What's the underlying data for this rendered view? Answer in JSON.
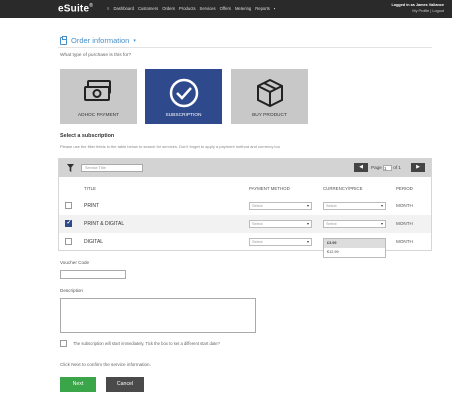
{
  "app": {
    "logo": "eSuite",
    "logo_mark": "®",
    "nav": [
      "Dashboard",
      "Customers",
      "Orders",
      "Products",
      "Services",
      "Offers",
      "Metering",
      "Reports"
    ],
    "user_line1": "Logged in as James Vallance",
    "user_line2": "My Profile | Logout"
  },
  "order": {
    "header": "Order information",
    "question": "What type of purchase is this for?",
    "types": [
      {
        "label": "ADHOC PAYMENT",
        "icon": "cash-icon",
        "selected": false
      },
      {
        "label": "SUBSCRIPTION",
        "icon": "checkmark-circle-icon",
        "selected": true
      },
      {
        "label": "BUY PRODUCT",
        "icon": "box-icon",
        "selected": false
      }
    ]
  },
  "subscription": {
    "title": "Select a subscription",
    "help": "Please use the filter fields in the table below to search for services. Don't forget to apply a payment method and currency too",
    "search_placeholder": "Service Title",
    "page_label": "Page",
    "page_value": "1",
    "page_of": "of 1",
    "columns": {
      "title": "TITLE",
      "payment": "PAYMENT METHOD",
      "currency": "CURRENCY/PRICE",
      "period": "PERIOD"
    },
    "rows": [
      {
        "title": "PRINT",
        "checked": false,
        "payment": "Select",
        "currency": "Select",
        "period": "MONTH"
      },
      {
        "title": "PRINT & DIGITAL",
        "checked": true,
        "payment": "Select",
        "currency": "Select",
        "period": "MONTH"
      },
      {
        "title": "DIGITAL",
        "checked": false,
        "payment": "Select",
        "currency": "Select",
        "period": "MONTH"
      }
    ],
    "currency_options": [
      "£3.99",
      "€12.99"
    ]
  },
  "form": {
    "voucher_label": "Voucher Code",
    "description_label": "Description",
    "start_text": "The subscription will start immediately. Tick the box to set a different start date?",
    "confirm_text": "Click Next to confirm the service information.",
    "next_label": "Next",
    "cancel_label": "Cancel"
  },
  "colors": {
    "accent": "#2e4a8c",
    "link": "#4a90c8",
    "next": "#3aa649",
    "cancel": "#4a4a4a"
  }
}
